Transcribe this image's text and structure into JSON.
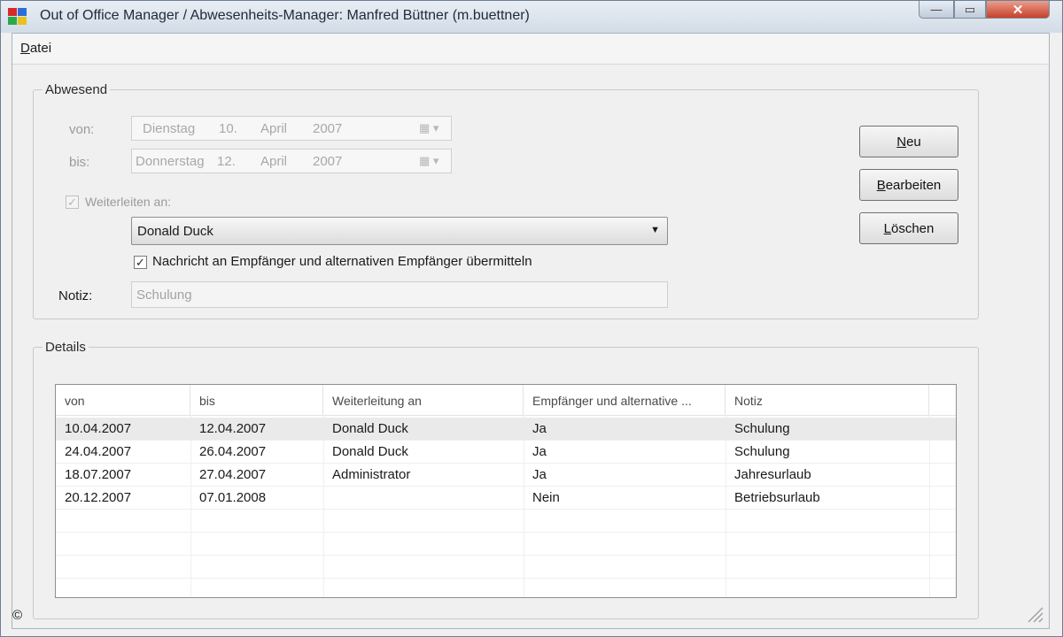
{
  "window": {
    "title": "Out of Office Manager / Abwesenheits-Manager: Manfred Büttner (m.buettner)",
    "min_glyph": "—",
    "max_glyph": "▭",
    "close_glyph": "✕"
  },
  "menu": {
    "file": "Datei"
  },
  "absent": {
    "legend": "Abwesend",
    "from_label": "von:",
    "to_label": "bis:",
    "from_date": {
      "weekday": "Dienstag",
      "day": "10.",
      "month": "April",
      "year": "2007"
    },
    "to_date": {
      "weekday": "Donnerstag",
      "day": "12.",
      "month": "April",
      "year": "2007"
    },
    "forward_label": "Weiterleiten an:",
    "forward_checked_glyph": "✓",
    "recipient": "Donald Duck",
    "notify_label": "Nachricht an Empfänger und alternativen Empfänger übermitteln",
    "notify_checked_glyph": "✓",
    "note_label": "Notiz:",
    "note_value": "Schulung"
  },
  "buttons": {
    "new": "Neu",
    "edit": "Bearbeiten",
    "delete": "Löschen"
  },
  "details": {
    "legend": "Details",
    "columns": [
      "von",
      "bis",
      "Weiterleitung an",
      "Empfänger und alternative ...",
      "Notiz"
    ],
    "rows": [
      [
        "10.04.2007",
        "12.04.2007",
        "Donald Duck",
        "Ja",
        "Schulung"
      ],
      [
        "24.04.2007",
        "26.04.2007",
        "Donald Duck",
        "Ja",
        "Schulung"
      ],
      [
        "18.07.2007",
        "27.04.2007",
        "Administrator",
        "Ja",
        "Jahresurlaub"
      ],
      [
        "20.12.2007",
        "07.01.2008",
        "",
        "Nein",
        "Betriebsurlaub"
      ]
    ],
    "selected_row": 0
  },
  "footer": {
    "copyright": "©"
  },
  "colors": {
    "close_button": "#c8412a",
    "selection": "#eaeaea"
  }
}
